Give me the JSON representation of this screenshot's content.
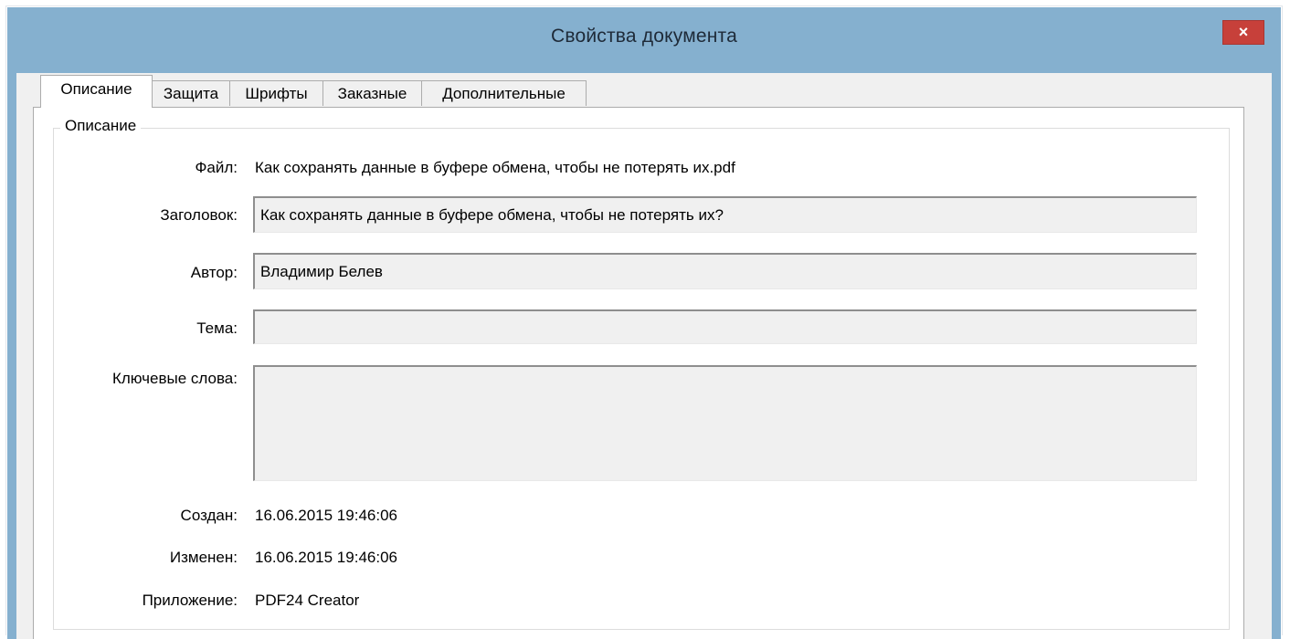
{
  "window": {
    "title": "Свойства документа",
    "close_glyph": "×"
  },
  "tabs": [
    {
      "label": "Описание",
      "active": true
    },
    {
      "label": "Защита",
      "active": false
    },
    {
      "label": "Шрифты",
      "active": false
    },
    {
      "label": "Заказные",
      "active": false
    },
    {
      "label": "Дополнительные",
      "active": false
    }
  ],
  "description": {
    "group_title": "Описание",
    "file_label": "Файл:",
    "file_value": "Как сохранять данные в буфере обмена, чтобы не потерять их.pdf",
    "title_label": "Заголовок:",
    "title_value": "Как сохранять данные в буфере обмена, чтобы не потерять их?",
    "author_label": "Автор:",
    "author_value": "Владимир Белев",
    "subject_label": "Тема:",
    "subject_value": "",
    "keywords_label": "Ключевые слова:",
    "keywords_value": "",
    "created_label": "Создан:",
    "created_value": "16.06.2015 19:46:06",
    "modified_label": "Изменен:",
    "modified_value": "16.06.2015 19:46:06",
    "application_label": "Приложение:",
    "application_value": "PDF24 Creator"
  },
  "colors": {
    "title_bar": "#85b0cf",
    "close_button": "#c7403a",
    "field_background": "#f0f0f0"
  }
}
